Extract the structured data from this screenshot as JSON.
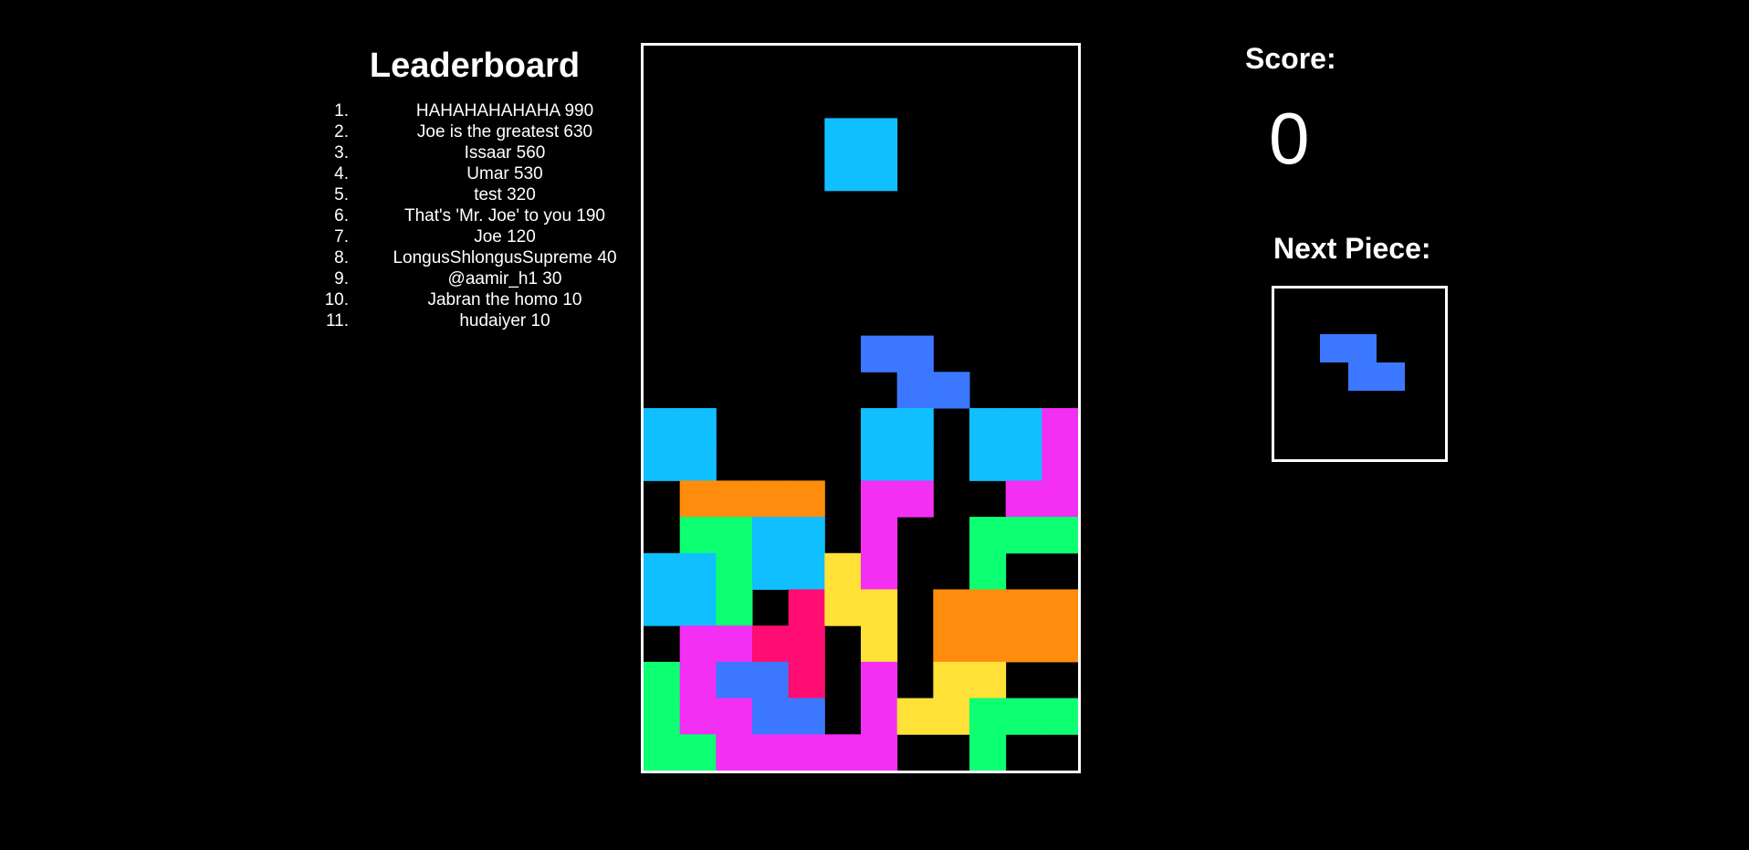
{
  "leaderboard": {
    "title": "Leaderboard",
    "entries": [
      {
        "rank": "1.",
        "text": "HAHAHAHAHAHA 990"
      },
      {
        "rank": "2.",
        "text": "Joe is the greatest 630"
      },
      {
        "rank": "3.",
        "text": "Issaar 560"
      },
      {
        "rank": "4.",
        "text": "Umar 530"
      },
      {
        "rank": "5.",
        "text": "test 320"
      },
      {
        "rank": "6.",
        "text": "That's 'Mr. Joe' to you 190"
      },
      {
        "rank": "7.",
        "text": "Joe 120"
      },
      {
        "rank": "8.",
        "text": "LongusShlongusSupreme 40"
      },
      {
        "rank": "9.",
        "text": "@aamir_h1 30"
      },
      {
        "rank": "10.",
        "text": "Jabran the homo 10"
      },
      {
        "rank": "11.",
        "text": "hudaiyer 10"
      }
    ]
  },
  "score": {
    "label": "Score:",
    "value": "0"
  },
  "next_piece": {
    "label": "Next Piece:",
    "color": "#3b78ff",
    "cells": [
      [
        0,
        0
      ],
      [
        1,
        0
      ],
      [
        1,
        1
      ],
      [
        2,
        1
      ]
    ]
  },
  "colors": {
    "C": "#10bfff",
    "B": "#3b78ff",
    "M": "#f22ff2",
    "O": "#ff8c0d",
    "G": "#0dff72",
    "Y": "#ffe138",
    "R": "#ff0d72"
  },
  "board": {
    "columns": 12,
    "rows": 20,
    "active_piece": {
      "color": "C",
      "cells": [
        [
          5,
          2
        ],
        [
          6,
          2
        ],
        [
          5,
          3
        ],
        [
          6,
          3
        ]
      ]
    },
    "grid": [
      "............",
      "............",
      "............",
      "............",
      "............",
      "............",
      "............",
      "............",
      "......BB....",
      ".......BB...",
      "CC....CC.CCM",
      "CC....CC.CCM",
      ".OOOO.MM..MM",
      ".GGCC.M..GGG",
      "CCGCCYM..G..",
      "CCG.RYY.OOOO",
      ".MMRR.Y.OOOO",
      "GMBBR.M.YY..",
      "GMMBB.MYYGGG",
      "GGMMMMM..G.."
    ]
  }
}
